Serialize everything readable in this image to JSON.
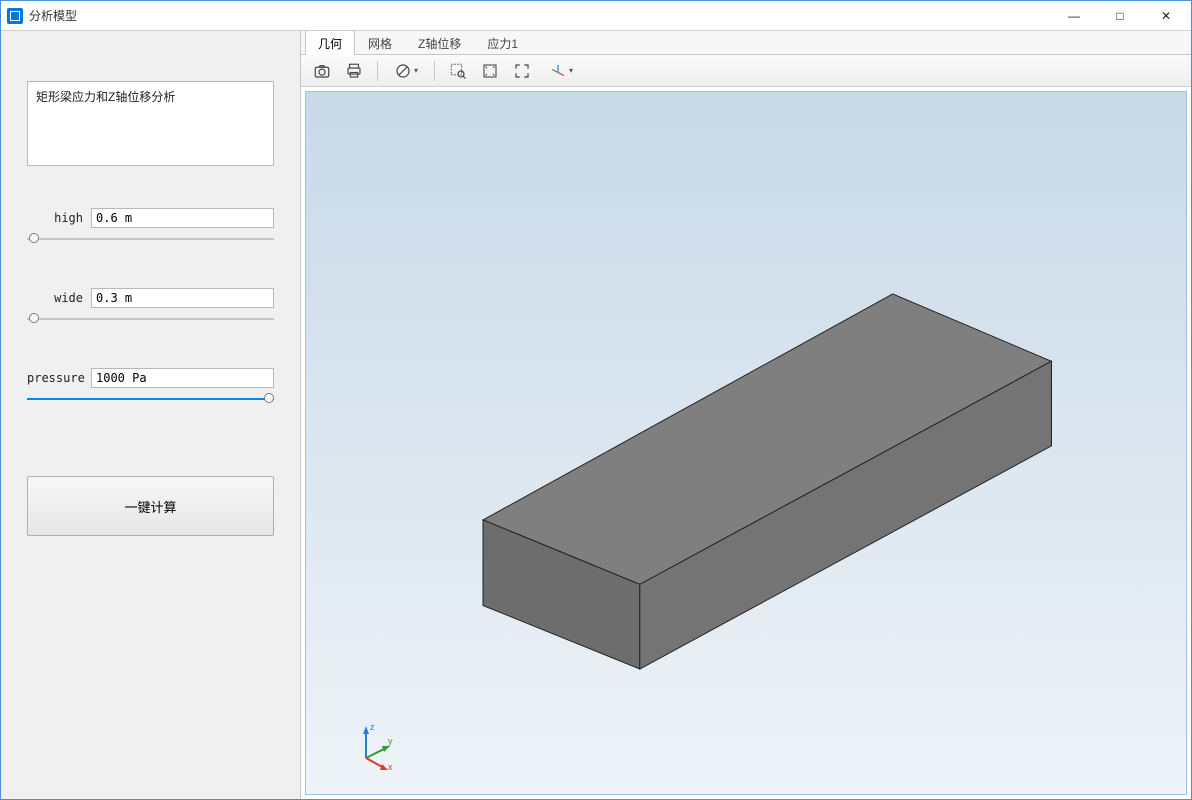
{
  "window": {
    "title": "分析模型"
  },
  "winbuttons": {
    "min": "—",
    "max": "□",
    "close": "✕"
  },
  "sidebar": {
    "description": "矩形梁应力和Z轴位移分析",
    "params": [
      {
        "label": "high",
        "value": "0.6 m",
        "slider_pos": 0.03,
        "active": false
      },
      {
        "label": "wide",
        "value": "0.3 m",
        "slider_pos": 0.03,
        "active": false
      },
      {
        "label": "pressure",
        "value": "1000 Pa",
        "slider_pos": 0.98,
        "active": true
      }
    ],
    "compute_label": "一键计算"
  },
  "tabs": [
    {
      "label": "几何",
      "active": true
    },
    {
      "label": "网格",
      "active": false
    },
    {
      "label": "Z轴位移",
      "active": false
    },
    {
      "label": "应力1",
      "active": false
    }
  ],
  "toolbar_icons": {
    "screenshot": "screenshot-icon",
    "print": "print-icon",
    "transparency": "transparency-icon",
    "zoom_box": "zoom-box-icon",
    "zoom_extents": "zoom-extents-icon",
    "fit": "fit-icon",
    "axis_view": "axis-view-icon"
  },
  "axis": {
    "x": "x",
    "y": "y",
    "z": "z"
  }
}
